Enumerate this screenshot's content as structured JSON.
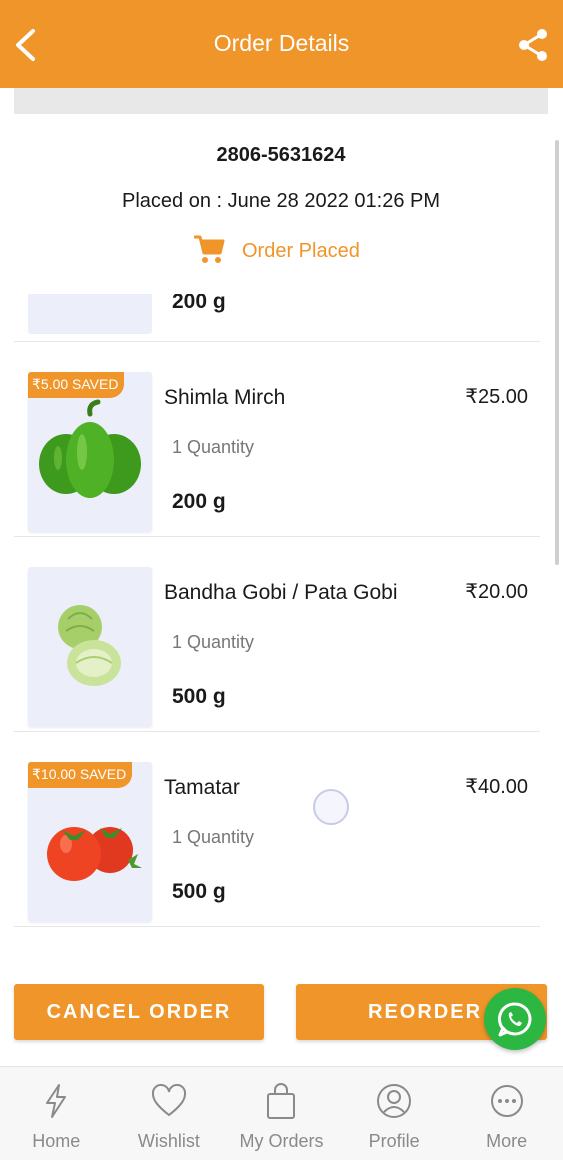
{
  "header": {
    "title": "Order Details"
  },
  "order": {
    "id": "2806-5631624",
    "placed_on": "Placed on : June 28 2022 01:26 PM",
    "status": "Order Placed"
  },
  "partial_item": {
    "weight": "200 g"
  },
  "items": [
    {
      "badge": "₹5.00 SAVED",
      "name": "Shimla Mirch",
      "price": "₹25.00",
      "qty": "1 Quantity",
      "weight": "200 g",
      "image": "green-capsicum"
    },
    {
      "badge": "",
      "name": "Bandha Gobi / Pata Gobi",
      "price": "₹20.00",
      "qty": "1 Quantity",
      "weight": "500 g",
      "image": "cabbage"
    },
    {
      "badge": "₹10.00 SAVED",
      "name": "Tamatar",
      "price": "₹40.00",
      "qty": "1 Quantity",
      "weight": "500 g",
      "image": "tomatoes"
    }
  ],
  "actions": {
    "cancel": "CANCEL ORDER",
    "reorder": "REORDER"
  },
  "nav": [
    {
      "label": "Home",
      "icon": "lightning-icon"
    },
    {
      "label": "Wishlist",
      "icon": "heart-icon"
    },
    {
      "label": "My Orders",
      "icon": "shopping-bag-icon"
    },
    {
      "label": "Profile",
      "icon": "profile-icon"
    },
    {
      "label": "More",
      "icon": "more-icon"
    }
  ],
  "colors": {
    "accent": "#f0952a",
    "whatsapp": "#2bb741"
  }
}
